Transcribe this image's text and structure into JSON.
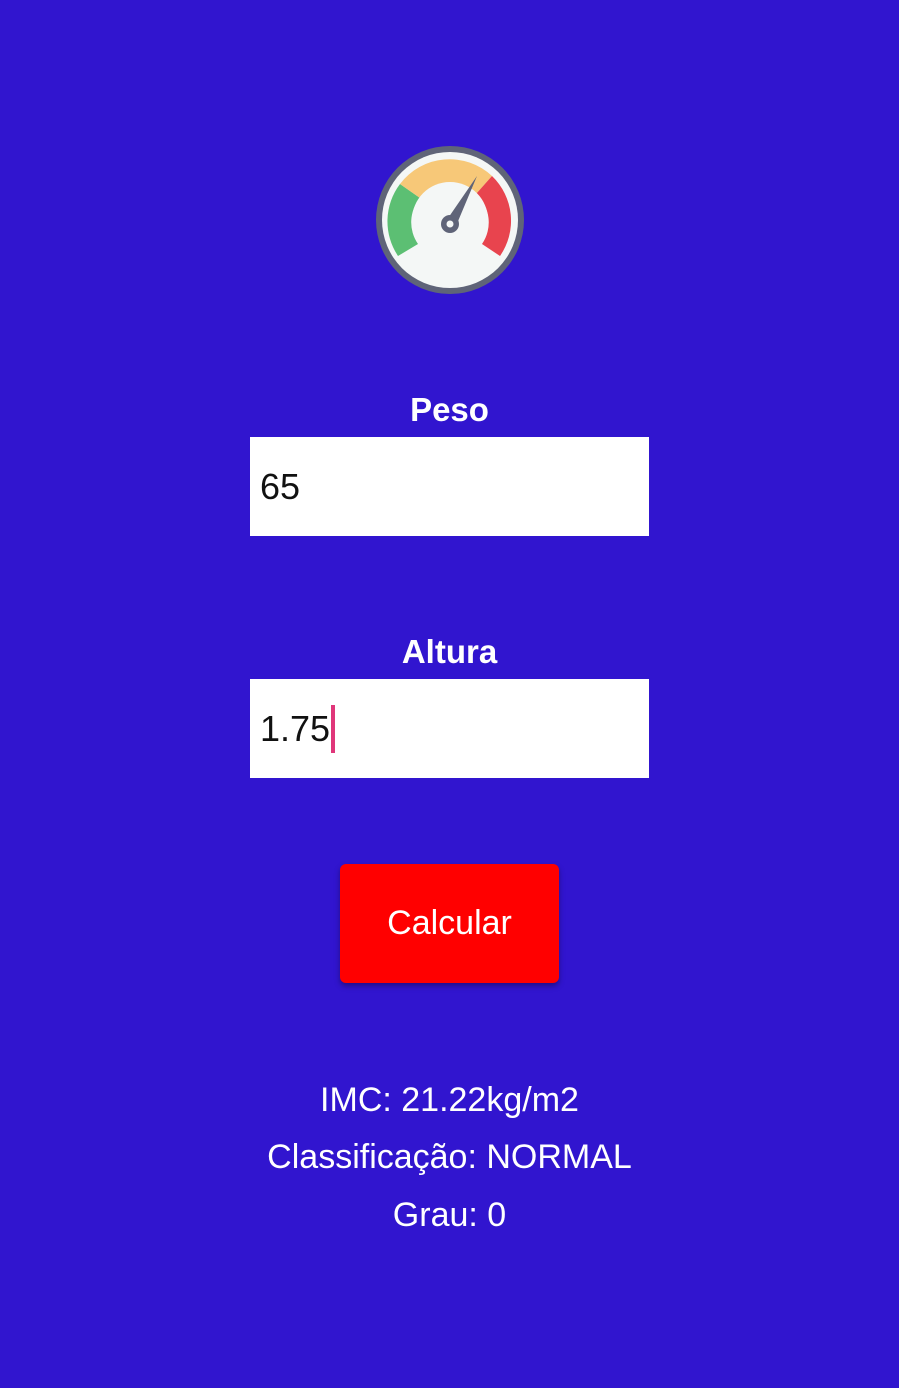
{
  "app": {
    "background_color": "#3115cf",
    "logo_icon": "speedometer-gauge-icon"
  },
  "form": {
    "peso": {
      "label": "Peso",
      "value": "65"
    },
    "altura": {
      "label": "Altura",
      "value": "1.75"
    },
    "calculate_button_label": "Calcular",
    "button_color": "#ff0000"
  },
  "results": {
    "imc": "IMC: 21.22kg/m2",
    "classificacao": "Classificação: NORMAL",
    "grau": "Grau: 0"
  }
}
